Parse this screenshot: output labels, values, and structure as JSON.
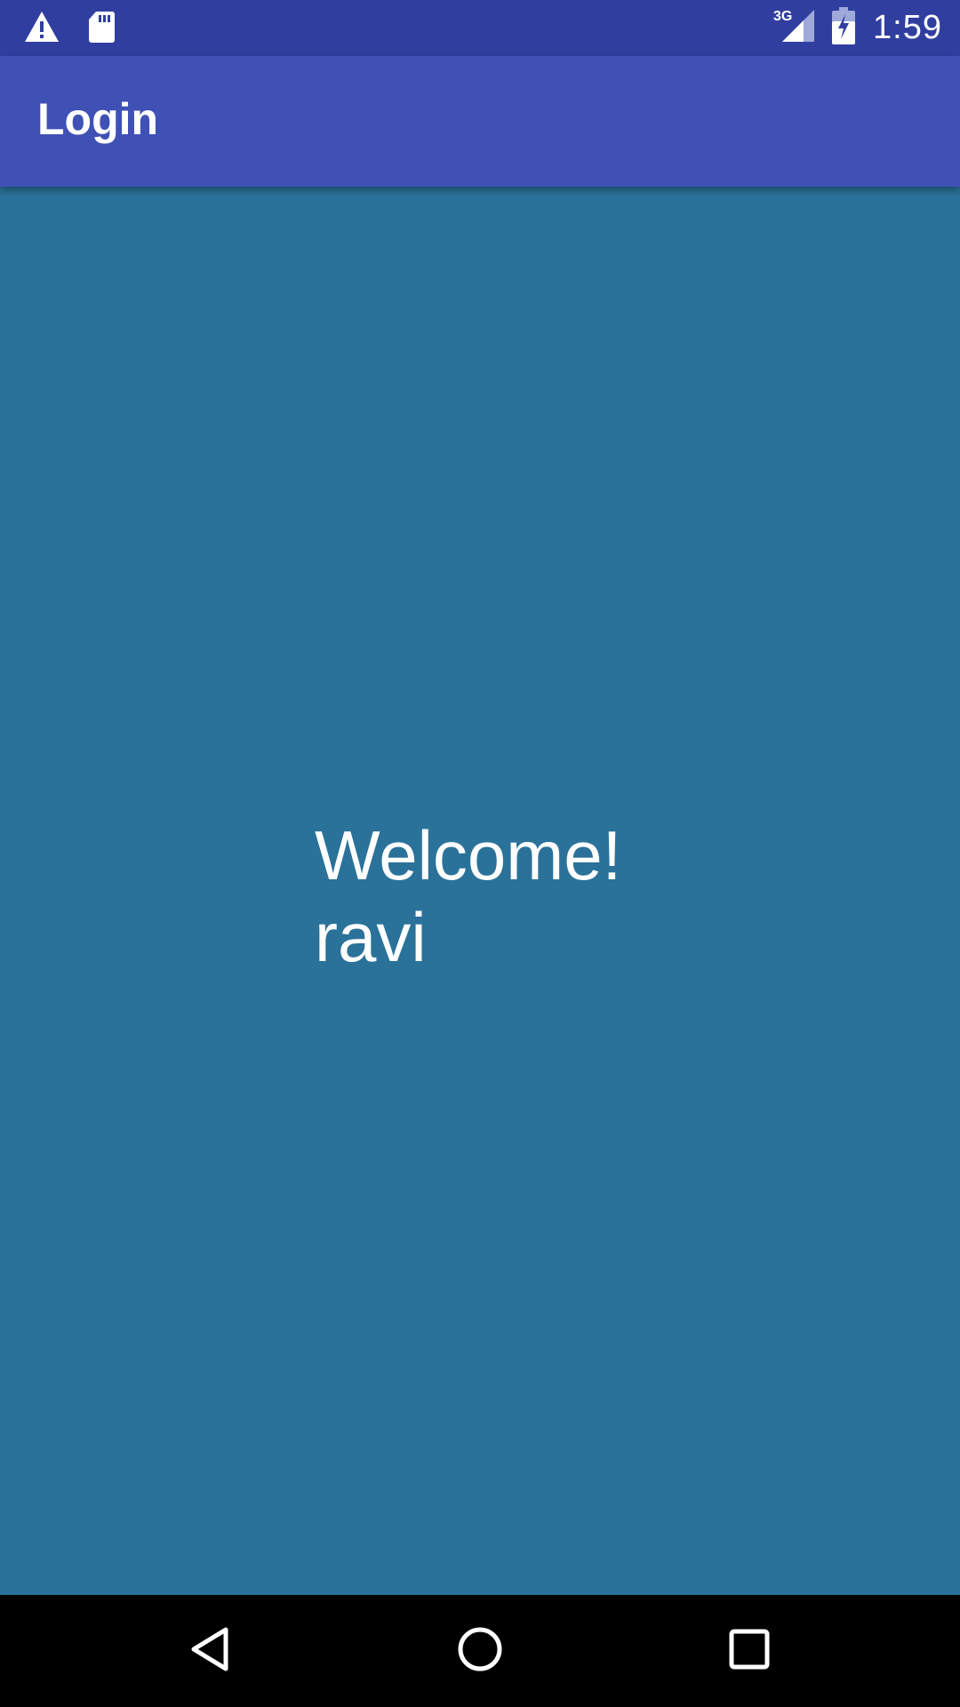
{
  "status_bar": {
    "left_icons": [
      "warning-icon",
      "sd-card-icon"
    ],
    "network_type": "3G",
    "time": "1:59"
  },
  "app_bar": {
    "title": "Login"
  },
  "content": {
    "welcome_text": "Welcome!",
    "username": "ravi"
  },
  "nav_bar": {
    "buttons": [
      "back-icon",
      "home-icon",
      "recents-icon"
    ]
  },
  "colors": {
    "status_bar": "#303f9f",
    "app_bar": "#3f51b5",
    "background": "#2a7299",
    "nav_bar": "#000000",
    "text": "#ffffff"
  }
}
